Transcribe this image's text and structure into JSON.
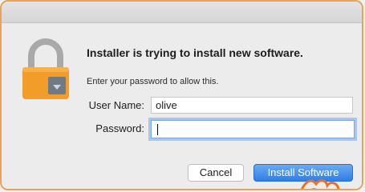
{
  "dialog": {
    "heading": "Installer is trying to install new software.",
    "subtext": "Enter your password to allow this.",
    "username_label": "User Name:",
    "username_value": "olive",
    "password_label": "Password:",
    "password_value": "",
    "cancel_label": "Cancel",
    "install_label": "Install Software"
  },
  "icons": {
    "lock": "lock-icon",
    "hand_cursor": "hand-pointer-icon"
  },
  "colors": {
    "accent_border": "#e8a25b",
    "primary_button": "#2f7ee6",
    "focus_ring": "#a7c7ef"
  }
}
